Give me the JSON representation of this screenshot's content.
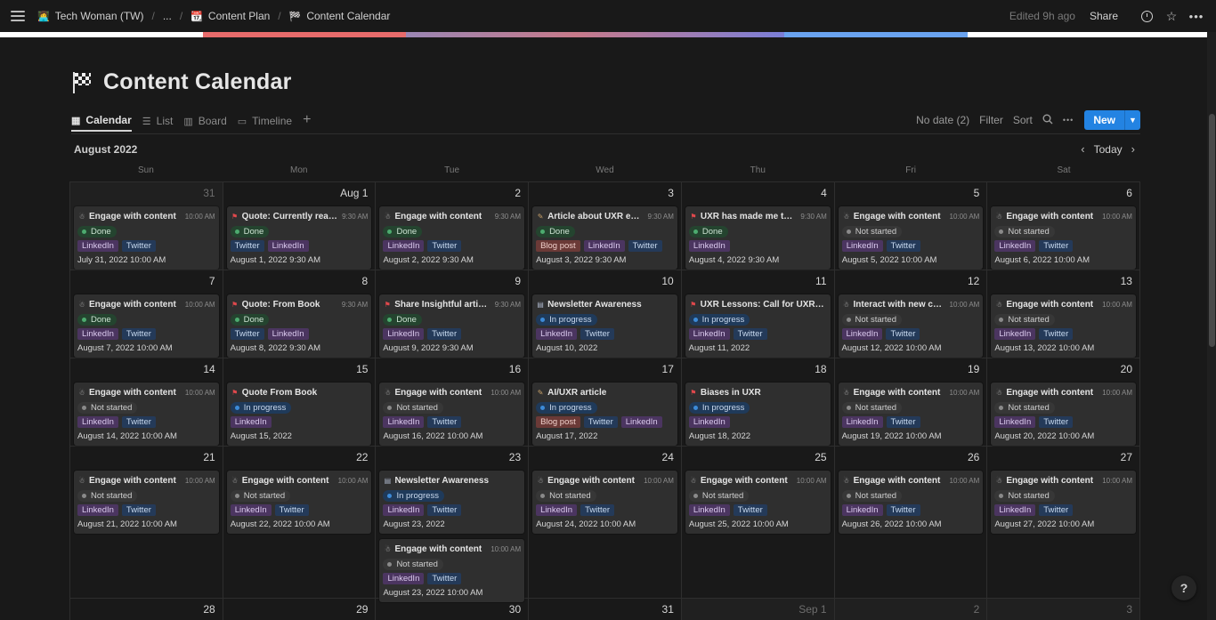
{
  "breadcrumb": {
    "workspace": "Tech Woman (TW)",
    "ellipsis": "...",
    "parent": "Content Plan",
    "current": "Content Calendar",
    "separator": "/"
  },
  "topbar": {
    "edited": "Edited 9h ago",
    "share": "Share"
  },
  "page": {
    "title": "Content Calendar"
  },
  "views": [
    {
      "label": "Calendar",
      "icon": "calendar-icon",
      "active": true
    },
    {
      "label": "List",
      "icon": "list-icon"
    },
    {
      "label": "Board",
      "icon": "board-icon"
    },
    {
      "label": "Timeline",
      "icon": "timeline-icon"
    }
  ],
  "view_actions": {
    "no_date": "No date (2)",
    "filter": "Filter",
    "sort": "Sort",
    "more": "•••",
    "new": "New"
  },
  "calendar": {
    "month": "August 2022",
    "today": "Today",
    "weekdays": [
      "Sun",
      "Mon",
      "Tue",
      "Wed",
      "Thu",
      "Fri",
      "Sat"
    ],
    "weeks": [
      [
        {
          "num": "31",
          "other": true,
          "cards": [
            {
              "icon": "person",
              "title": "Engage with content",
              "time": "10:00 AM",
              "status": "Done",
              "tags": [
                "LinkedIn",
                "Twitter"
              ],
              "date": "July 31, 2022 10:00 AM"
            }
          ]
        },
        {
          "num": "Aug 1",
          "cards": [
            {
              "icon": "flag",
              "title": "Quote: Currently readi...",
              "time": "9:30 AM",
              "status": "Done",
              "tags": [
                "Twitter",
                "LinkedIn"
              ],
              "date": "August 1, 2022 9:30 AM"
            }
          ]
        },
        {
          "num": "2",
          "cards": [
            {
              "icon": "person",
              "title": "Engage with content",
              "time": "9:30 AM",
              "status": "Done",
              "tags": [
                "LinkedIn",
                "Twitter"
              ],
              "date": "August 2, 2022 9:30 AM"
            }
          ]
        },
        {
          "num": "3",
          "cards": [
            {
              "icon": "pen",
              "title": "Article about UXR edu...",
              "time": "9:30 AM",
              "status": "Done",
              "tags": [
                "Blog post",
                "LinkedIn",
                "Twitter"
              ],
              "date": "August 3, 2022 9:30 AM"
            }
          ]
        },
        {
          "num": "4",
          "cards": [
            {
              "icon": "flag",
              "title": "UXR has made me to b...",
              "time": "9:30 AM",
              "status": "Done",
              "tags": [
                "LinkedIn"
              ],
              "date": "August 4, 2022 9:30 AM"
            }
          ]
        },
        {
          "num": "5",
          "cards": [
            {
              "icon": "person",
              "title": "Engage with content",
              "time": "10:00 AM",
              "status": "Not started",
              "tags": [
                "LinkedIn",
                "Twitter"
              ],
              "date": "August 5, 2022 10:00 AM"
            }
          ]
        },
        {
          "num": "6",
          "cards": [
            {
              "icon": "person",
              "title": "Engage with content",
              "time": "10:00 AM",
              "status": "Not started",
              "tags": [
                "LinkedIn",
                "Twitter"
              ],
              "date": "August 6, 2022 10:00 AM"
            }
          ]
        }
      ],
      [
        {
          "num": "7",
          "cards": [
            {
              "icon": "person",
              "title": "Engage with content",
              "time": "10:00 AM",
              "status": "Done",
              "tags": [
                "LinkedIn",
                "Twitter"
              ],
              "date": "August 7, 2022 10:00 AM"
            }
          ]
        },
        {
          "num": "8",
          "cards": [
            {
              "icon": "flag",
              "title": "Quote: From Book",
              "time": "9:30 AM",
              "status": "Done",
              "tags": [
                "Twitter",
                "LinkedIn"
              ],
              "date": "August 8, 2022 9:30 AM"
            }
          ]
        },
        {
          "num": "9",
          "cards": [
            {
              "icon": "flag",
              "title": "Share Insightful article...",
              "time": "9:30 AM",
              "status": "Done",
              "tags": [
                "LinkedIn",
                "Twitter"
              ],
              "date": "August 9, 2022 9:30 AM"
            }
          ]
        },
        {
          "num": "10",
          "cards": [
            {
              "icon": "doc",
              "title": "Newsletter Awareness",
              "time": "",
              "status": "In progress",
              "tags": [
                "LinkedIn",
                "Twitter"
              ],
              "date": "August 10, 2022"
            }
          ]
        },
        {
          "num": "11",
          "cards": [
            {
              "icon": "flag",
              "title": "UXR Lessons: Call for UXRs fro...",
              "time": "",
              "status": "In progress",
              "tags": [
                "LinkedIn",
                "Twitter"
              ],
              "date": "August 11, 2022"
            }
          ]
        },
        {
          "num": "12",
          "cards": [
            {
              "icon": "person",
              "title": "Interact with new con...",
              "time": "10:00 AM",
              "status": "Not started",
              "tags": [
                "LinkedIn",
                "Twitter"
              ],
              "date": "August 12, 2022 10:00 AM"
            }
          ]
        },
        {
          "num": "13",
          "cards": [
            {
              "icon": "person",
              "title": "Engage with content",
              "time": "10:00 AM",
              "status": "Not started",
              "tags": [
                "LinkedIn",
                "Twitter"
              ],
              "date": "August 13, 2022 10:00 AM"
            }
          ]
        }
      ],
      [
        {
          "num": "14",
          "cards": [
            {
              "icon": "person",
              "title": "Engage with content",
              "time": "10:00 AM",
              "status": "Not started",
              "tags": [
                "LinkedIn",
                "Twitter"
              ],
              "date": "August 14, 2022 10:00 AM"
            }
          ]
        },
        {
          "num": "15",
          "cards": [
            {
              "icon": "flag",
              "title": "Quote From Book",
              "time": "",
              "status": "In progress",
              "tags": [
                "LinkedIn"
              ],
              "date": "August 15, 2022"
            }
          ]
        },
        {
          "num": "16",
          "cards": [
            {
              "icon": "person",
              "title": "Engage with content",
              "time": "10:00 AM",
              "status": "Not started",
              "tags": [
                "LinkedIn",
                "Twitter"
              ],
              "date": "August 16, 2022 10:00 AM"
            }
          ]
        },
        {
          "num": "17",
          "cards": [
            {
              "icon": "pen",
              "title": "AI/UXR article",
              "time": "",
              "status": "In progress",
              "tags": [
                "Blog post",
                "Twitter",
                "LinkedIn"
              ],
              "date": "August 17, 2022"
            }
          ]
        },
        {
          "num": "18",
          "cards": [
            {
              "icon": "flag",
              "title": "Biases in UXR",
              "time": "",
              "status": "In progress",
              "tags": [
                "LinkedIn"
              ],
              "date": "August 18, 2022"
            }
          ]
        },
        {
          "num": "19",
          "cards": [
            {
              "icon": "person",
              "title": "Engage with content",
              "time": "10:00 AM",
              "status": "Not started",
              "tags": [
                "LinkedIn",
                "Twitter"
              ],
              "date": "August 19, 2022 10:00 AM"
            }
          ]
        },
        {
          "num": "20",
          "cards": [
            {
              "icon": "person",
              "title": "Engage with content",
              "time": "10:00 AM",
              "status": "Not started",
              "tags": [
                "LinkedIn",
                "Twitter"
              ],
              "date": "August 20, 2022 10:00 AM"
            }
          ]
        }
      ],
      [
        {
          "num": "21",
          "cards": [
            {
              "icon": "person",
              "title": "Engage with content",
              "time": "10:00 AM",
              "status": "Not started",
              "tags": [
                "LinkedIn",
                "Twitter"
              ],
              "date": "August 21, 2022 10:00 AM"
            }
          ]
        },
        {
          "num": "22",
          "cards": [
            {
              "icon": "person",
              "title": "Engage with content",
              "time": "10:00 AM",
              "status": "Not started",
              "tags": [
                "LinkedIn",
                "Twitter"
              ],
              "date": "August 22, 2022 10:00 AM"
            }
          ]
        },
        {
          "num": "23",
          "cards": [
            {
              "icon": "doc",
              "title": "Newsletter Awareness",
              "time": "",
              "status": "In progress",
              "tags": [
                "LinkedIn",
                "Twitter"
              ],
              "date": "August 23, 2022"
            },
            {
              "icon": "person",
              "title": "Engage with content",
              "time": "10:00 AM",
              "status": "Not started",
              "tags": [
                "LinkedIn",
                "Twitter"
              ],
              "date": "August 23, 2022 10:00 AM"
            }
          ]
        },
        {
          "num": "24",
          "cards": [
            {
              "icon": "person",
              "title": "Engage with content",
              "time": "10:00 AM",
              "status": "Not started",
              "tags": [
                "LinkedIn",
                "Twitter"
              ],
              "date": "August 24, 2022 10:00 AM"
            }
          ]
        },
        {
          "num": "25",
          "cards": [
            {
              "icon": "person",
              "title": "Engage with content",
              "time": "10:00 AM",
              "status": "Not started",
              "tags": [
                "LinkedIn",
                "Twitter"
              ],
              "date": "August 25, 2022 10:00 AM"
            }
          ]
        },
        {
          "num": "26",
          "cards": [
            {
              "icon": "person",
              "title": "Engage with content",
              "time": "10:00 AM",
              "status": "Not started",
              "tags": [
                "LinkedIn",
                "Twitter"
              ],
              "date": "August 26, 2022 10:00 AM"
            }
          ]
        },
        {
          "num": "27",
          "cards": [
            {
              "icon": "person",
              "title": "Engage with content",
              "time": "10:00 AM",
              "status": "Not started",
              "tags": [
                "LinkedIn",
                "Twitter"
              ],
              "date": "August 27, 2022 10:00 AM"
            }
          ]
        }
      ],
      [
        {
          "num": "28",
          "cards": []
        },
        {
          "num": "29",
          "cards": []
        },
        {
          "num": "30",
          "cards": []
        },
        {
          "num": "31",
          "cards": []
        },
        {
          "num": "Sep 1",
          "other": true,
          "cards": []
        },
        {
          "num": "2",
          "other": true,
          "cards": []
        },
        {
          "num": "3",
          "other": true,
          "cards": []
        }
      ]
    ]
  },
  "help": "?",
  "colors": {
    "accent": "#2383e2",
    "done": "#4dab6f",
    "in_progress": "#3d8bd8"
  }
}
